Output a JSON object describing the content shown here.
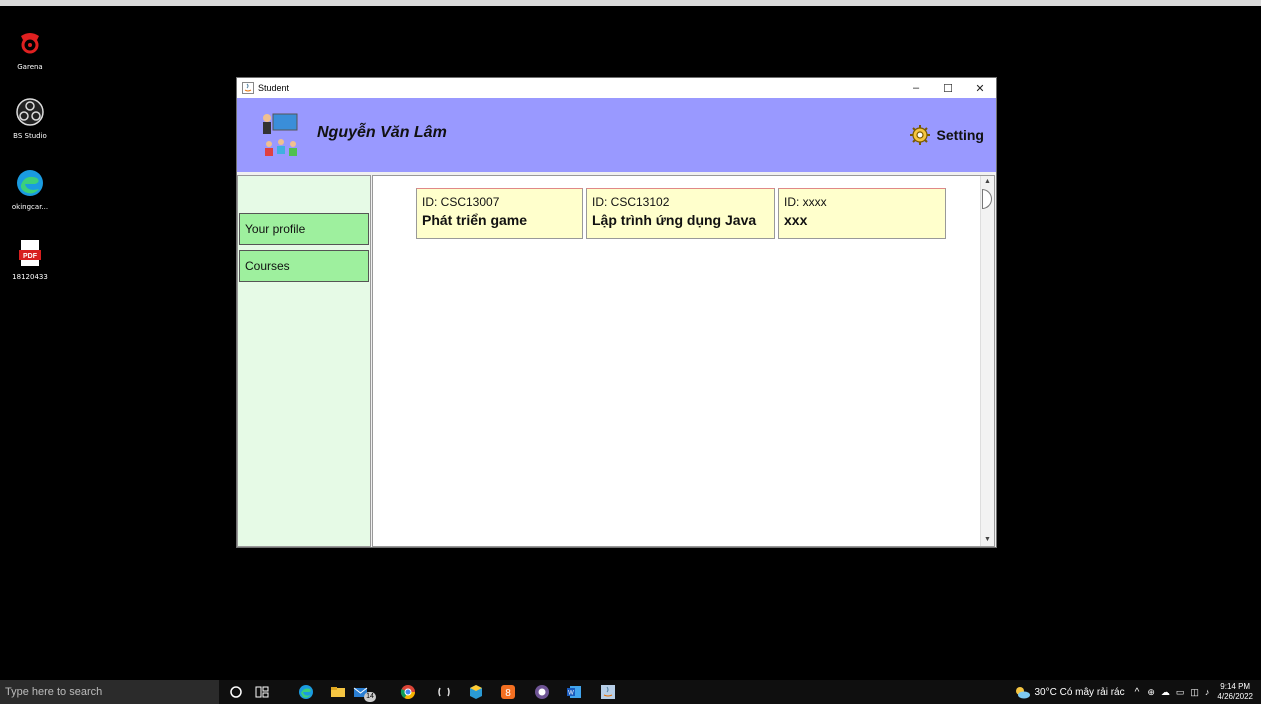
{
  "desktop": {
    "icons": [
      {
        "label": "Garena"
      },
      {
        "label": "BS Studio"
      },
      {
        "label": "okingcar..."
      },
      {
        "label": "18120433"
      }
    ]
  },
  "window": {
    "title": "Student",
    "controls": {
      "minimize": "–",
      "maximize": "☐",
      "close": "✕"
    }
  },
  "header": {
    "username": "Nguyễn Văn Lâm",
    "setting_label": "Setting",
    "background": "#9999ff"
  },
  "sidebar": {
    "items": [
      {
        "label": "Your profile"
      },
      {
        "label": "Courses"
      }
    ]
  },
  "courses": [
    {
      "id": "ID: CSC13007",
      "name": "Phát triển game"
    },
    {
      "id": "ID: CSC13102",
      "name": "Lập trình ứng dụng Java"
    },
    {
      "id": "ID: xxxx",
      "name": "xxx"
    }
  ],
  "taskbar": {
    "search_placeholder": "Type here to search",
    "weather": "30°C  Có mây rải rác",
    "time": "9:14 PM",
    "date": "4/26/2022",
    "badge": "14"
  }
}
